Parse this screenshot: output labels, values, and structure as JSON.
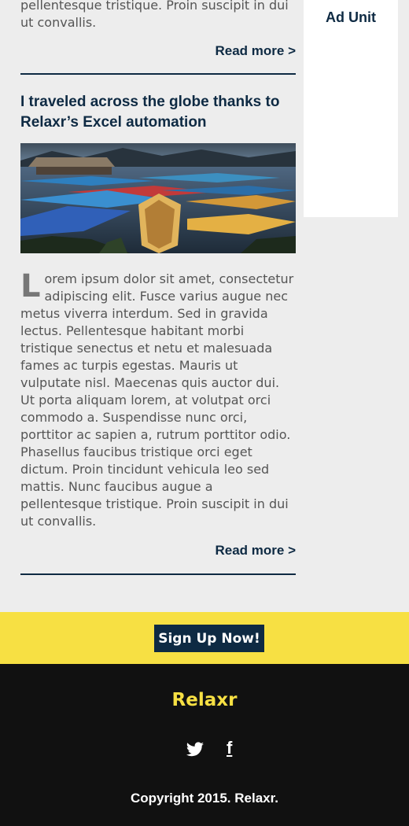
{
  "prev_article": {
    "text_tail": "pellentesque tristique. Proin suscipit in dui ut convallis.",
    "read_more": "Read more >"
  },
  "article": {
    "title": "I traveled across the globe thanks to Relaxr’s Excel automation",
    "image_icon": "boats-on-lake-photo",
    "body_first_letter": "L",
    "body_rest": "orem ipsum dolor sit amet, consectetur adipiscing elit. Fusce varius augue nec metus viverra interdum. Sed in gravida lectus. Pellentesque habitant morbi tristique senectus et netu et malesuada fames ac turpis egestas. Mauris ut vulputate nisl. Maecenas quis auctor dui. Ut porta aliquam lorem, at volutpat orci commodo a. Suspendisse nunc orci, porttitor ac sapien a, rutrum porttitor odio. Phasellus faucibus tristique orci eget dictum. Proin tincidunt vehicula leo sed mattis. Nunc faucibus augue a pellentesque tristique. Proin suscipit in dui ut convallis.",
    "read_more": "Read more >"
  },
  "sidebar": {
    "ad_label": "Ad Unit"
  },
  "signup": {
    "button_label": "Sign Up Now!"
  },
  "footer": {
    "brand": "Relaxr",
    "social": [
      {
        "icon": "twitter-icon"
      },
      {
        "icon": "facebook-icon",
        "glyph": "f"
      }
    ],
    "copyright": "Copyright 2015. Relaxr."
  },
  "colors": {
    "navy": "#0e2a43",
    "yellow": "#f7e043",
    "page_bg": "#ededed",
    "footer_bg": "#111111"
  }
}
